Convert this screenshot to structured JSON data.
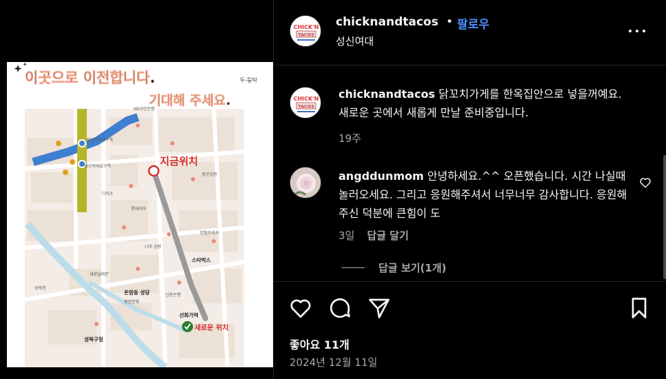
{
  "post": {
    "username": "chicknandtacos",
    "follow_label": "팔로우",
    "dot": "•",
    "location": "성신여대",
    "likes": "좋아요 11개",
    "date": "2024년 12월 11일"
  },
  "logo": {
    "line1": "CHICK'N",
    "line2": "TACOS"
  },
  "image": {
    "headline1": "이곳으로 이전합니다.",
    "headline2": "기대해 주세요.",
    "signature": "두-둥탁",
    "current_label": "지금위치",
    "new_label": "새로운 위치",
    "labels": {
      "station": "성신여대입구역",
      "station2": "성신여대입구역",
      "daiso": "다이소",
      "starbucks": "스타벅스",
      "church": "돈암동 성당",
      "office": "성북구청",
      "bank": "신한은행",
      "shinhwa": "선화가역",
      "kb": "KB국민은행",
      "seoulbank": "새로일레븐",
      "dongsung": "동선공원",
      "hanbit": "한빛프라자",
      "lotte": "롯데리아",
      "naju": "나주 곰탕",
      "jungang": "중앙문화",
      "seongbuk_cheon": "성북천"
    }
  },
  "caption": {
    "username": "chicknandtacos",
    "text": "닭꼬치가게를 한옥집안으로 넣을꺼예요. 새로운 곳에서 새롭게 만날 준비중입니다.",
    "time": "19주"
  },
  "comment": {
    "username": "angddunmom",
    "text": "안녕하세요.^^ 오픈했습니다. 시간 나실때 놀러오세요. 그리고 응원해주셔서 너무너무 감사합니다. 응원해 주신 덕분에 큰힘이 도",
    "time": "3일",
    "reply_label": "답글 달기"
  },
  "view_replies_label": "답글 보기(1개)",
  "icons": {
    "like": "heart-icon",
    "comment": "comment-bubble-icon",
    "share": "paper-plane-icon",
    "save": "bookmark-icon",
    "more": "more-horizontal-icon"
  },
  "colors": {
    "background": "#000000",
    "follow": "#4a8cff",
    "secondary_text": "#a8a8a8",
    "route": "#9a9a9a",
    "marker_red": "#d32f2f",
    "marker_green": "#2e7d32",
    "metro_line": "#b5b52a",
    "road_blue": "#3f7fd0"
  }
}
